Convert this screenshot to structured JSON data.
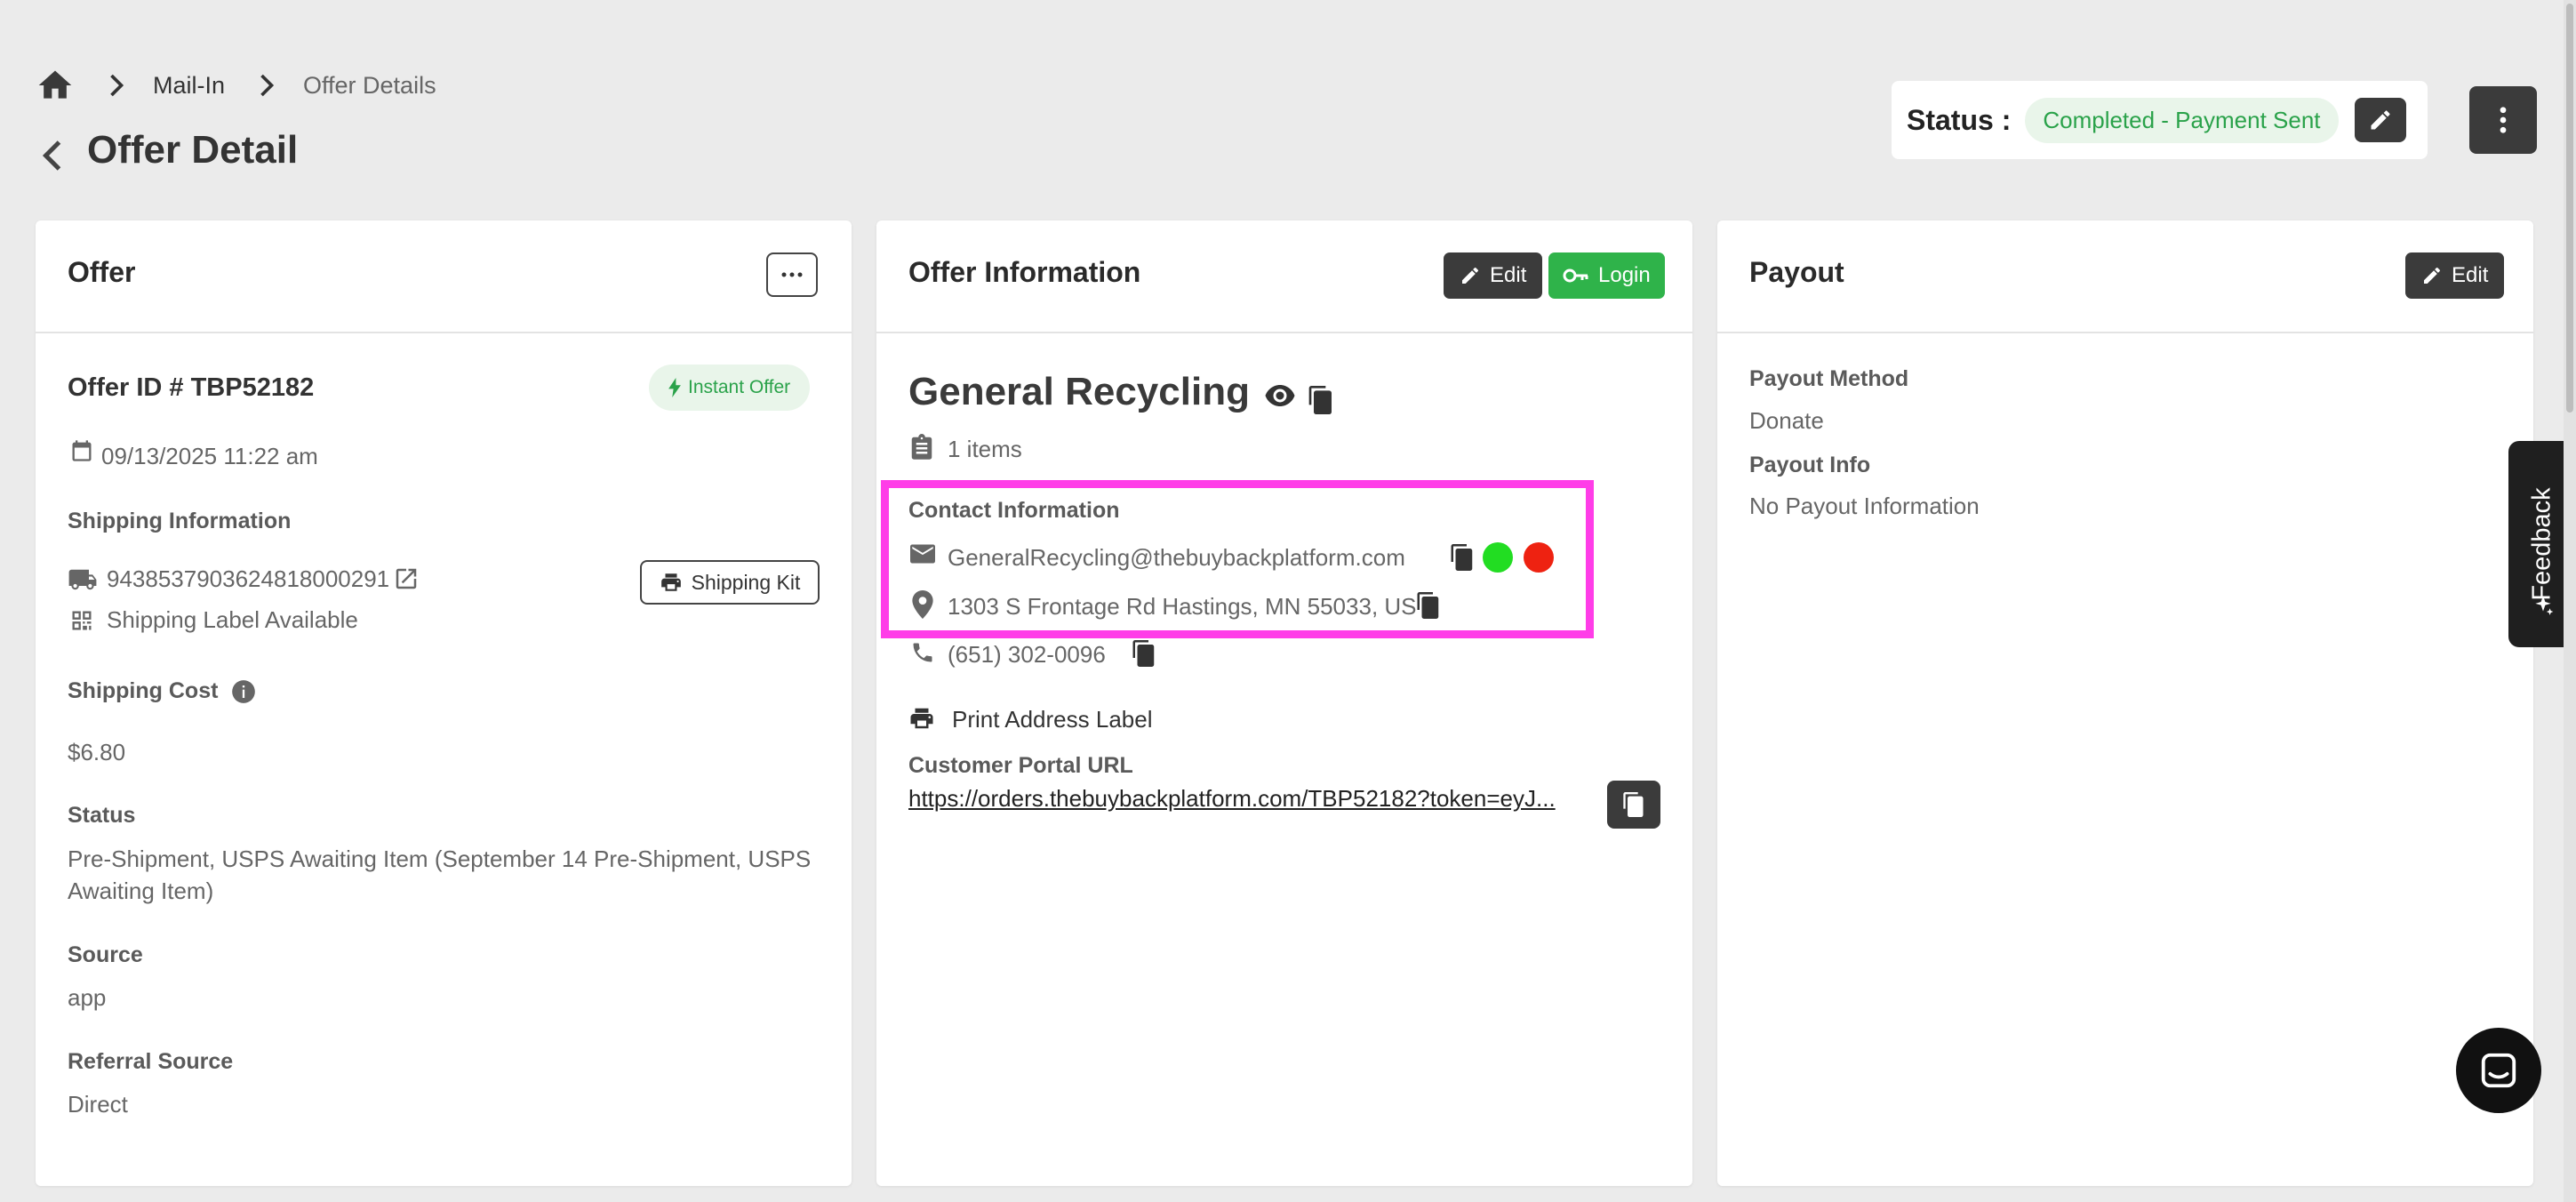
{
  "breadcrumb": {
    "items": [
      "Mail-In",
      "Offer Details"
    ]
  },
  "page_title": "Offer Detail",
  "status": {
    "label": "Status :",
    "value": "Completed - Payment Sent",
    "value_color": "#2aa24a"
  },
  "offer_card": {
    "title": "Offer",
    "offer_id": "Offer ID # TBP52182",
    "badge": "Instant Offer",
    "date": "09/13/2025 11:22 am",
    "shipping_info_label": "Shipping Information",
    "tracking_number": "9438537903624818000291",
    "shipping_kit_button": "Shipping Kit",
    "shipping_label_status": "Shipping Label Available",
    "shipping_cost_label": "Shipping Cost",
    "shipping_cost": "$6.80",
    "status_label": "Status",
    "status_value": "Pre-Shipment, USPS Awaiting Item (September 14 Pre-Shipment, USPS Awaiting Item)",
    "source_label": "Source",
    "source_value": "app",
    "referral_label": "Referral Source",
    "referral_value": "Direct"
  },
  "offer_info_card": {
    "title": "Offer Information",
    "edit_button": "Edit",
    "login_button": "Login",
    "customer_name": "General Recycling",
    "items_count": "1 items",
    "contact_label": "Contact Information",
    "email": "GeneralRecycling@thebuybackplatform.com",
    "address": "1303 S Frontage Rd Hastings, MN 55033, US",
    "phone": "(651) 302-0096",
    "print_label": "Print Address Label",
    "portal_label": "Customer Portal URL",
    "portal_url": "https://orders.thebuybackplatform.com/TBP52182?token=eyJ..."
  },
  "payout_card": {
    "title": "Payout",
    "edit_button": "Edit",
    "method_label": "Payout Method",
    "method_value": "Donate",
    "info_label": "Payout Info",
    "info_value": "No Payout Information"
  },
  "feedback_tab": "Feedback",
  "colors": {
    "accent_green": "#2fb34a",
    "dark_button": "#3b3b3b",
    "highlight": "#ff3de8",
    "indicator_green": "#22dd22",
    "indicator_red": "#ee2211"
  }
}
